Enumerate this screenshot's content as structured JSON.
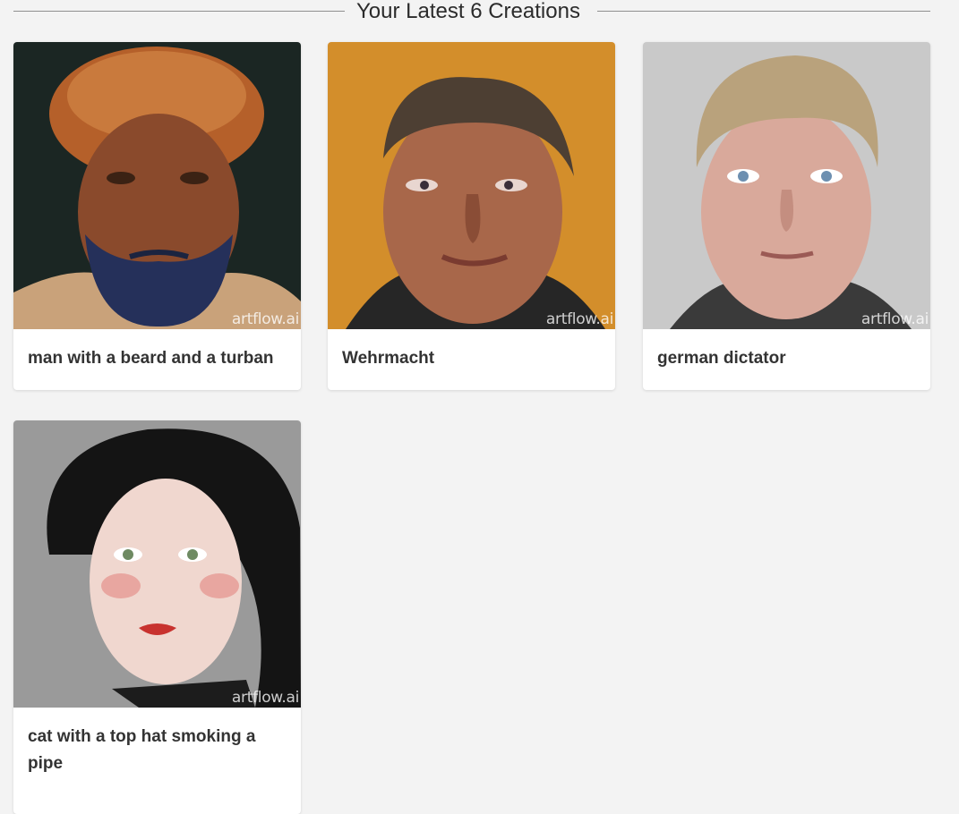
{
  "section": {
    "heading": "Your Latest 6 Creations"
  },
  "watermark": "artflow.ai",
  "cards": [
    {
      "title": "man with a beard and a turban",
      "image_subject": "bearded-man-portrait"
    },
    {
      "title": "Wehrmacht",
      "image_subject": "soldier-portrait"
    },
    {
      "title": "german dictator",
      "image_subject": "blond-man-portrait"
    },
    {
      "title": "cat with a top hat smoking a pipe",
      "image_subject": "woman-portrait"
    }
  ],
  "colors": {
    "page_background": "#f3f3f3",
    "card_background": "#ffffff",
    "title_text": "#333333"
  }
}
